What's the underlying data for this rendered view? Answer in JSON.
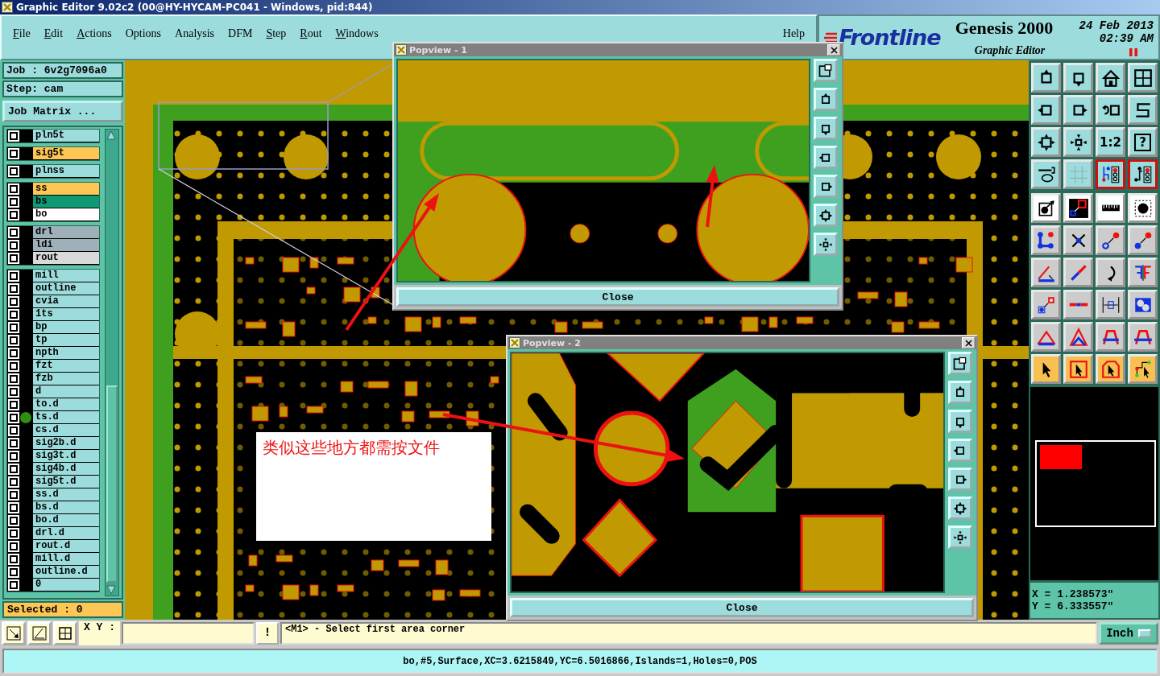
{
  "window": {
    "title": "Graphic Editor 9.02c2 (00@HY-HYCAM-PC041 - Windows, pid:844)"
  },
  "menu": [
    {
      "label": "File",
      "mnemonic": true
    },
    {
      "label": "Edit",
      "mnemonic": true
    },
    {
      "label": "Actions",
      "mnemonic": true
    },
    {
      "label": "Options",
      "mnemonic": false
    },
    {
      "label": "Analysis",
      "mnemonic": false
    },
    {
      "label": "DFM",
      "mnemonic": false
    },
    {
      "label": "Step",
      "mnemonic": true
    },
    {
      "label": "Rout",
      "mnemonic": true
    },
    {
      "label": "Windows",
      "mnemonic": true
    },
    {
      "label": "Help",
      "mnemonic": false
    }
  ],
  "branding": {
    "logo": "Frontline",
    "product": "Genesis 2000",
    "subtitle": "Graphic Editor",
    "date": "24 Feb 2013",
    "time": "02:39 AM"
  },
  "job": {
    "job": "Job : 6v2g7096a0",
    "step": "Step: cam",
    "matrix_button": "Job Matrix ..."
  },
  "layer_groups": [
    {
      "layers": [
        {
          "name": "pln5t",
          "color": "#9ddcdc",
          "checked": false,
          "active": false
        }
      ]
    },
    {
      "layers": [
        {
          "name": "sig5t",
          "color": "#fdc655",
          "checked": false,
          "active": false
        }
      ]
    },
    {
      "layers": [
        {
          "name": "plnss",
          "color": "#9ddcdc",
          "checked": false,
          "active": false
        }
      ]
    },
    {
      "layers": [
        {
          "name": "ss",
          "color": "#fdc655",
          "checked": false,
          "active": false
        },
        {
          "name": "bs",
          "color": "#0f9a74",
          "checked": false,
          "active": false
        },
        {
          "name": "bo",
          "color": "#ffffff",
          "checked": false,
          "active": false
        }
      ]
    },
    {
      "layers": [
        {
          "name": "drl",
          "color": "#9fb1b8",
          "checked": false,
          "active": false
        },
        {
          "name": "ldi",
          "color": "#9fb1b8",
          "checked": false,
          "active": false
        },
        {
          "name": "rout",
          "color": "#d9d9d9",
          "checked": false,
          "active": false
        }
      ]
    },
    {
      "layers": [
        {
          "name": "mill",
          "color": "#9ddcdc",
          "checked": false,
          "active": false
        },
        {
          "name": "outline",
          "color": "#9ddcdc",
          "checked": false,
          "active": false
        },
        {
          "name": "cvia",
          "color": "#9ddcdc",
          "checked": false,
          "active": false
        },
        {
          "name": "1ts",
          "color": "#9ddcdc",
          "checked": false,
          "active": false
        },
        {
          "name": "bp",
          "color": "#9ddcdc",
          "checked": false,
          "active": false
        },
        {
          "name": "tp",
          "color": "#9ddcdc",
          "checked": false,
          "active": false
        },
        {
          "name": "npth",
          "color": "#9ddcdc",
          "checked": false,
          "active": false
        },
        {
          "name": "fzt",
          "color": "#9ddcdc",
          "checked": false,
          "active": false
        },
        {
          "name": "fzb",
          "color": "#9ddcdc",
          "checked": false,
          "active": false
        },
        {
          "name": "d",
          "color": "#9ddcdc",
          "checked": false,
          "active": false
        },
        {
          "name": "to.d",
          "color": "#9ddcdc",
          "checked": false,
          "active": false
        },
        {
          "name": "ts.d",
          "color": "#9ddcdc",
          "checked": false,
          "active": true
        },
        {
          "name": "cs.d",
          "color": "#9ddcdc",
          "checked": false,
          "active": false
        },
        {
          "name": "sig2b.d",
          "color": "#9ddcdc",
          "checked": false,
          "active": false
        },
        {
          "name": "sig3t.d",
          "color": "#9ddcdc",
          "checked": false,
          "active": false
        },
        {
          "name": "sig4b.d",
          "color": "#9ddcdc",
          "checked": false,
          "active": false
        },
        {
          "name": "sig5t.d",
          "color": "#9ddcdc",
          "checked": false,
          "active": false
        },
        {
          "name": "ss.d",
          "color": "#9ddcdc",
          "checked": false,
          "active": false
        },
        {
          "name": "bs.d",
          "color": "#9ddcdc",
          "checked": false,
          "active": false
        },
        {
          "name": "bo.d",
          "color": "#9ddcdc",
          "checked": false,
          "active": false
        },
        {
          "name": "drl.d",
          "color": "#9ddcdc",
          "checked": false,
          "active": false
        },
        {
          "name": "rout.d",
          "color": "#9ddcdc",
          "checked": false,
          "active": false
        },
        {
          "name": "mill.d",
          "color": "#9ddcdc",
          "checked": false,
          "active": false
        },
        {
          "name": "outline.d",
          "color": "#9ddcdc",
          "checked": false,
          "active": false
        },
        {
          "name": "0",
          "color": "#9ddcdc",
          "checked": false,
          "active": false
        }
      ]
    }
  ],
  "selected_count": "Selected : 0",
  "tools": [
    {
      "on": false
    },
    {
      "on": false
    },
    {
      "on": false
    },
    {
      "on": false
    },
    {
      "on": false
    },
    {
      "on": false
    },
    {
      "on": false
    },
    {
      "on": false
    },
    {
      "on": false
    },
    {
      "on": false
    },
    {
      "on": false,
      "label": "1:2"
    },
    {
      "on": false,
      "label": "?"
    },
    {
      "on": false
    },
    {
      "on": false
    },
    {
      "on": true
    },
    {
      "on": true
    },
    {
      "on": false
    },
    {
      "on": false
    },
    {
      "on": false
    },
    {
      "on": false
    },
    {
      "on": false
    },
    {
      "on": false
    },
    {
      "on": false
    },
    {
      "on": false
    },
    {
      "on": false
    },
    {
      "on": false
    },
    {
      "on": false
    },
    {
      "on": false
    },
    {
      "on": false
    },
    {
      "on": false
    },
    {
      "on": false
    },
    {
      "on": false
    },
    {
      "on": false
    },
    {
      "on": false
    },
    {
      "on": false
    },
    {
      "on": false
    },
    {
      "on": false
    },
    {
      "on": false
    },
    {
      "on": false
    },
    {
      "on": false
    }
  ],
  "coordinates": {
    "x": "X = 1.238573\"",
    "y": "Y = 6.333557\""
  },
  "command_bar": {
    "xy_label": "X Y :",
    "alert_button": "!",
    "prompt": "<M1> - Select first area corner",
    "units": "Inch"
  },
  "status_bar": "bo,#5,Surface,XC=3.6215849,YC=6.5016866,Islands=1,Holes=0,POS",
  "popups": [
    {
      "title": "Popview - 1",
      "close_button": "Close"
    },
    {
      "title": "Popview - 2",
      "close_button": "Close"
    }
  ],
  "annotation": {
    "text": "类似这些地方都需按文件"
  }
}
